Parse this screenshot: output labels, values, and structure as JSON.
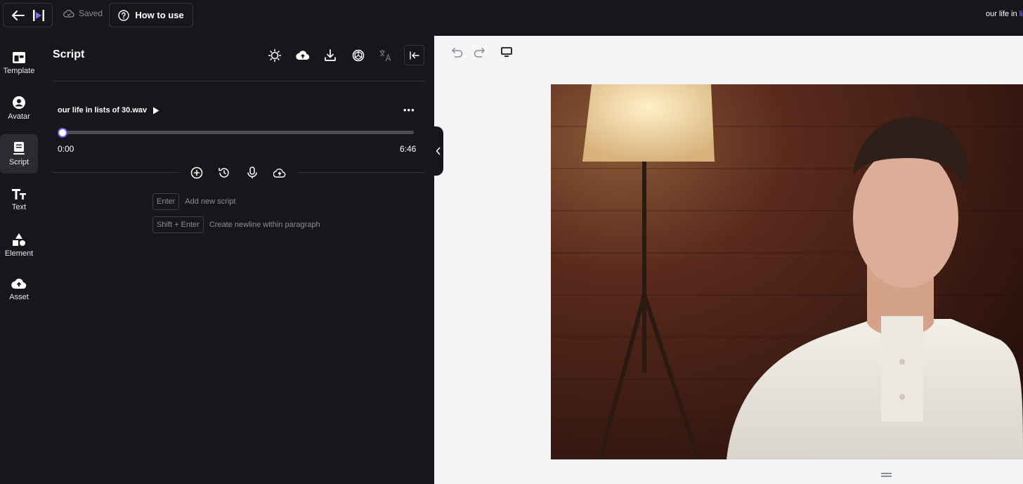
{
  "topbar": {
    "saved_label": "Saved",
    "how_to_use_label": "How to use",
    "project_name_prefix": "our life in ",
    "project_name_suffix": "li"
  },
  "rail": {
    "items": [
      {
        "label": "Template",
        "icon": "template-icon"
      },
      {
        "label": "Avatar",
        "icon": "avatar-icon"
      },
      {
        "label": "Script",
        "icon": "script-icon",
        "active": true
      },
      {
        "label": "Text",
        "icon": "text-icon"
      },
      {
        "label": "Element",
        "icon": "shapes-icon"
      },
      {
        "label": "Asset",
        "icon": "cloud-upload-icon"
      }
    ]
  },
  "panel": {
    "title": "Script",
    "toolbar_icons": [
      "lightbulb-icon",
      "cloud-upload-icon",
      "download-icon",
      "openai-icon",
      "translate-icon",
      "collapse-icon"
    ],
    "audio": {
      "file_name": "our life in lists of 30.wav",
      "current_time": "0:00",
      "duration": "6:46",
      "progress": 0
    },
    "actions": [
      "add-icon",
      "history-icon",
      "microphone-icon",
      "upload-icon"
    ],
    "shortcuts": [
      {
        "key": "Enter",
        "description": "Add new script"
      },
      {
        "key": "Shift + Enter",
        "description": "Create newline within paragraph"
      }
    ]
  },
  "canvas": {
    "tools": [
      "undo-icon",
      "redo-icon",
      "monitor-icon"
    ]
  },
  "colors": {
    "background": "#16171b",
    "accent": "#6c5ce7",
    "canvas": "#f4f5f7"
  }
}
